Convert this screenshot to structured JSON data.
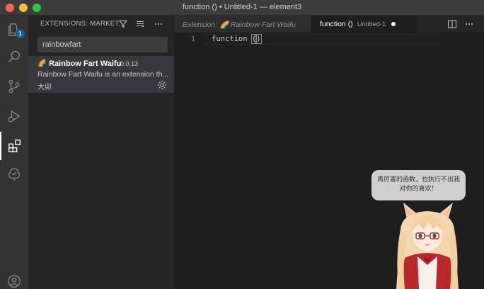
{
  "window": {
    "title": "function () • Untitled-1 — element3"
  },
  "activity_bar": {
    "explorer_badge": "1",
    "items": [
      "explorer",
      "search",
      "source-control",
      "run-debug",
      "extensions",
      "remote-explorer",
      "accounts"
    ]
  },
  "sidebar": {
    "title": "EXTENSIONS: MARKET...",
    "search_value": "rainbowfart",
    "extension": {
      "logo": "🌈",
      "name": "Rainbow Fart Waifu",
      "version": "0.0.13",
      "description": "Rainbow Fart Waifu is an extension th...",
      "author": "大卯"
    }
  },
  "tabs": [
    {
      "label": "Extension: 🌈 Rainbow Fart Waifu",
      "active": false
    },
    {
      "label": "function ()",
      "sublabel": "Untitled-1",
      "active": true,
      "dirty": true
    }
  ],
  "editor": {
    "line_number": "1",
    "code_keyword": "function ",
    "code_open": "(",
    "code_close": ")"
  },
  "bubble": {
    "text": "再厉害的函数，也执行不出我对你的喜欢！"
  },
  "colors": {
    "accent_badge": "#0e639c",
    "sidebar_bg": "#252526",
    "editor_bg": "#1e1e1e",
    "activity_bg": "#333333"
  }
}
